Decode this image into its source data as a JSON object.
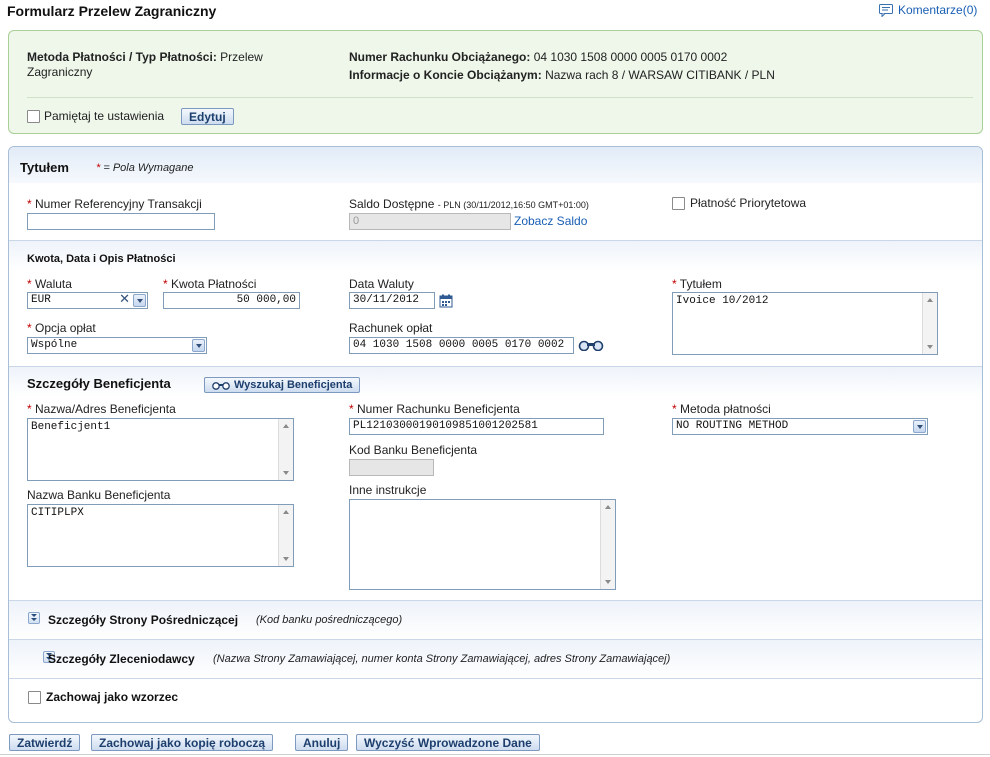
{
  "page": {
    "title": "Formularz Przelew Zagraniczny",
    "comments_label": "Komentarze(0)"
  },
  "summary": {
    "method_label": "Metoda Płatności / Typ Płatności:",
    "method_value": "Przelew Zagraniczny",
    "account_label": "Numer Rachunku Obciążanego:",
    "account_value": "04 1030 1508 0000 0005 0170 0002",
    "info_label": "Informacje o Koncie Obciążanym:",
    "info_value": "Nazwa rach 8 / WARSAW CITIBANK / PLN",
    "remember_label": "Pamiętaj te ustawienia",
    "edit_button": "Edytuj"
  },
  "header": {
    "section_title": "Tytułem",
    "required_marker": "*",
    "required_note": "= Pola Wymagane"
  },
  "general": {
    "ref_label": "Numer Referencyjny Transakcji",
    "ref_value": "",
    "balance_label": "Saldo Dostępne",
    "balance_meta": "- PLN (30/11/2012,16:50 GMT+01:00)",
    "balance_value": "0",
    "see_balance_link": "Zobacz Saldo",
    "priority_label": "Płatność Priorytetowa"
  },
  "payment": {
    "section_title": "Kwota, Data i Opis Płatności",
    "currency_label": "Waluta",
    "currency_value": "EUR",
    "amount_label": "Kwota Płatności",
    "amount_value": "50 000,00",
    "value_date_label": "Data Waluty",
    "value_date": "30/11/2012",
    "title_label": "Tytułem",
    "title_value": "Ivoice 10/2012",
    "fee_option_label": "Opcja opłat",
    "fee_option_value": "Wspólne",
    "fee_account_label": "Rachunek opłat",
    "fee_account_value": "04 1030 1508 0000 0005 0170 0002"
  },
  "beneficiary": {
    "section_title": "Szczegóły Beneficjenta",
    "search_button": "Wyszukaj Beneficjenta",
    "name_label": "Nazwa/Adres Beneficjenta",
    "name_value": "Beneficjent1",
    "account_label": "Numer Rachunku Beneficjenta",
    "account_value": "PL12103000190109851001202581",
    "method_label": "Metoda płatności",
    "method_value": "NO ROUTING METHOD",
    "bank_code_label": "Kod Banku Beneficjenta",
    "bank_code_value": "",
    "bank_name_label": "Nazwa Banku Beneficjenta",
    "bank_name_value": "CITIPLPX",
    "other_instr_label": "Inne instrukcje",
    "other_instr_value": ""
  },
  "intermediary": {
    "title": "Szczegóły Strony Pośredniczącej",
    "note": "(Kod banku pośredniczącego)"
  },
  "ordering": {
    "title": "Szczegóły Zleceniodawcy",
    "note": "(Nazwa Strony Zamawiającej, numer konta Strony Zamawiającej, adres Strony Zamawiającej)"
  },
  "template": {
    "save_label": "Zachowaj jako wzorzec"
  },
  "actions": {
    "approve": "Zatwierdź",
    "save_draft": "Zachowaj jako kopię roboczą",
    "cancel": "Anuluj",
    "clear": "Wyczyść Wprowadzone Dane"
  },
  "colors": {
    "link": "#1a5fb4",
    "required": "#c00000",
    "summary_bg": "#eef7ea",
    "panel_border": "#a8bdd6"
  }
}
